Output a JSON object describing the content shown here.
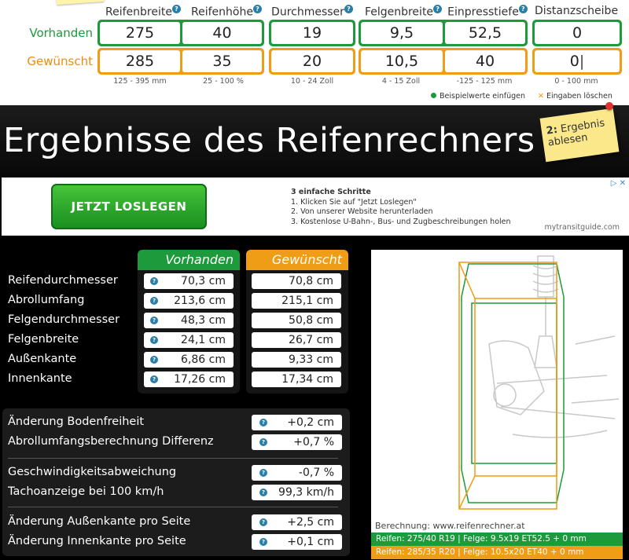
{
  "inputs": {
    "headers": {
      "reifenbreite": "Reifenbreite",
      "reifenhoehe": "Reifenhöhe",
      "durchmesser": "Durchmesser",
      "felgenbreite": "Felgenbreite",
      "einpresstiefe": "Einpresstiefe",
      "distanzscheibe": "Distanzscheibe"
    },
    "rows": {
      "vorhanden": {
        "label": "Vorhanden",
        "reifenbreite": "275",
        "reifenhoehe": "40",
        "durchmesser": "19",
        "felgenbreite": "9,5",
        "einpresstiefe": "52,5",
        "distanzscheibe": "0"
      },
      "gewuenscht": {
        "label": "Gewünscht",
        "reifenbreite": "285",
        "reifenhoehe": "35",
        "durchmesser": "20",
        "felgenbreite": "10,5",
        "einpresstiefe": "40",
        "distanzscheibe": "0"
      }
    },
    "ranges": {
      "reifenbreite": "125 - 395 mm",
      "reifenhoehe": "25 - 100 %",
      "durchmesser": "10 - 24 Zoll",
      "felgenbreite": "4 - 15 Zoll",
      "einpresstiefe": "-125 - 125 mm",
      "distanzscheibe": "0 - 100 mm"
    },
    "actions": {
      "example": "Beispielwerte einfügen",
      "clear": "Eingaben löschen"
    },
    "colors": {
      "vorhanden": "#1d9a3b",
      "gewuenscht": "#ef9c17"
    }
  },
  "title": "Ergebnisse des Reifenrechners",
  "sticky_note": {
    "number": "2:",
    "text": "Ergebnis ablesen"
  },
  "ad": {
    "button": "JETZT LOSLEGEN",
    "heading": "3 einfache Schritte",
    "steps": [
      "1. Klicken Sie auf \"Jetzt Loslegen\"",
      "2. Von unserer Website herunterladen",
      "3. Kostenlose U-Bahn-, Bus- und Zugbeschreibungen holen"
    ],
    "domain": "mytransitguide.com",
    "info_icon": "ad-info-icon"
  },
  "results": {
    "column_vorhanden": "Vorhanden",
    "column_gewuenscht": "Gewünscht",
    "rows": [
      {
        "label": "Reifendurchmesser",
        "vorhanden": "70,3 cm",
        "gewuenscht": "70,8 cm"
      },
      {
        "label": "Abrollumfang",
        "vorhanden": "213,6 cm",
        "gewuenscht": "215,1 cm"
      },
      {
        "label": "Felgendurchmesser",
        "vorhanden": "48,3 cm",
        "gewuenscht": "50,8 cm"
      },
      {
        "label": "Felgenbreite",
        "vorhanden": "24,1 cm",
        "gewuenscht": "26,7 cm"
      },
      {
        "label": "Außenkante",
        "vorhanden": "6,86 cm",
        "gewuenscht": "9,33 cm"
      },
      {
        "label": "Innenkante",
        "vorhanden": "17,26 cm",
        "gewuenscht": "17,34 cm"
      }
    ],
    "differences": [
      {
        "label": "Änderung Bodenfreiheit",
        "value": "+0,2 cm"
      },
      {
        "label": "Abrollumfangsberechnung Differenz",
        "value": "+0,7 %"
      },
      {
        "label": "Geschwindigkeitsabweichung",
        "value": "-0,7 %"
      },
      {
        "label": "Tachoanzeige bei 100 km/h",
        "value": "99,3 km/h"
      },
      {
        "label": "Änderung Außenkante pro Seite",
        "value": "+2,5 cm"
      },
      {
        "label": "Änderung Innenkante pro Seite",
        "value": "+0,1 cm"
      }
    ]
  },
  "diagram": {
    "credit": "Berechnung: www.reifenrechner.at",
    "tyre_vorhanden": "Reifen: 275/40 R19  |  Felge: 9.5x19 ET52.5 + 0 mm",
    "tyre_gewuenscht": "Reifen: 285/35 R20  |  Felge: 10.5x20 ET40 + 0 mm"
  }
}
